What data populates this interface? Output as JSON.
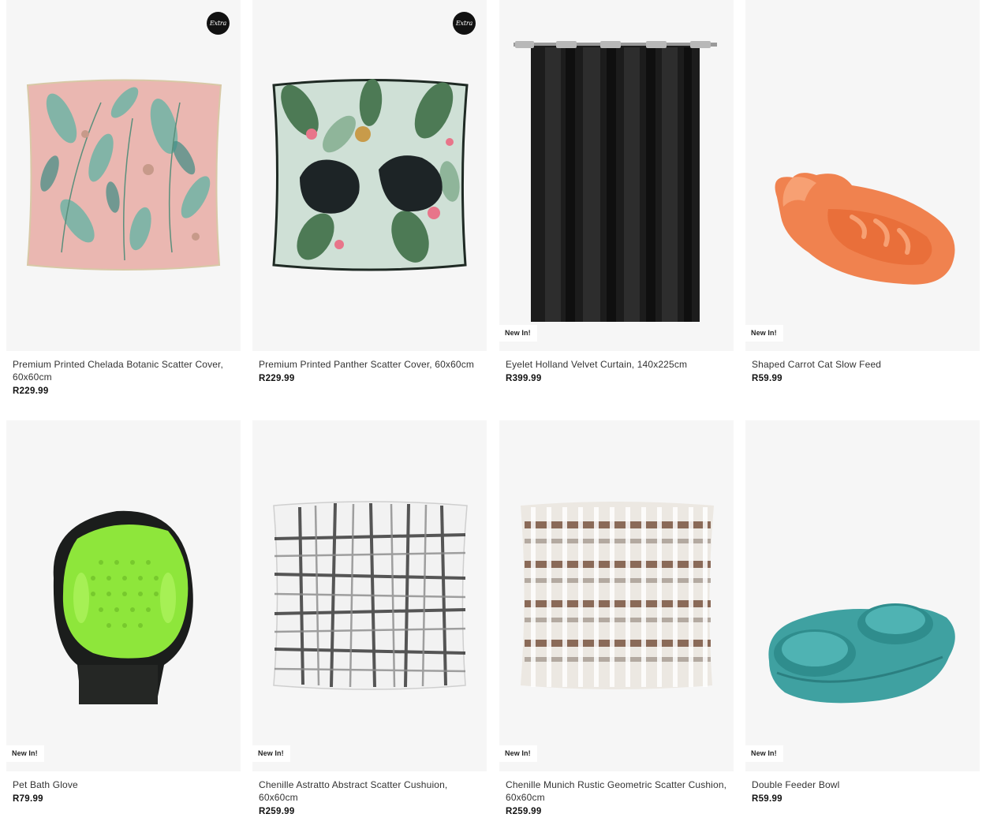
{
  "products": [
    {
      "title": "Premium Printed Chelada Botanic Scatter Cover, 60x60cm",
      "price": "R229.99",
      "badge_text": "Extra",
      "image_icon": "botanic-cushion-image"
    },
    {
      "title": "Premium Printed Panther Scatter Cover, 60x60cm",
      "price": "R229.99",
      "badge_text": "Extra",
      "image_icon": "panther-cushion-image"
    },
    {
      "title": "Eyelet Holland Velvet Curtain, 140x225cm",
      "price": "R399.99",
      "new_label": "New In!",
      "image_icon": "curtain-image"
    },
    {
      "title": "Shaped Carrot Cat Slow Feed",
      "price": "R59.99",
      "new_label": "New In!",
      "image_icon": "carrot-bowl-image"
    },
    {
      "title": "Pet Bath Glove",
      "price": "R79.99",
      "new_label": "New In!",
      "image_icon": "bath-glove-image"
    },
    {
      "title": "Chenille Astratto Abstract Scatter Cushuion, 60x60cm",
      "price": "R259.99",
      "new_label": "New In!",
      "image_icon": "abstract-cushion-image"
    },
    {
      "title": "Chenille Munich Rustic Geometric Scatter Cushion, 60x60cm",
      "price": "R259.99",
      "new_label": "New In!",
      "image_icon": "geometric-cushion-image"
    },
    {
      "title": "Double Feeder Bowl",
      "price": "R59.99",
      "new_label": "New In!",
      "image_icon": "double-bowl-image"
    }
  ],
  "colors": {
    "card_bg": "#f6f6f6",
    "badge_dark": "#111111",
    "price_text": "#111111",
    "title_text": "#333333"
  }
}
